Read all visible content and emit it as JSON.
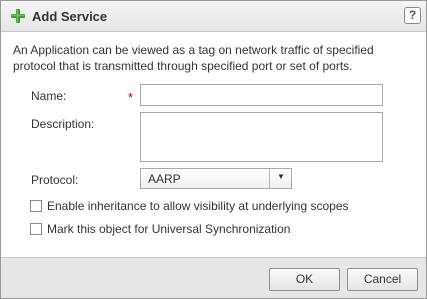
{
  "dialog": {
    "title": "Add Service",
    "title_icon": "green-plus-icon",
    "help_label": "?",
    "accent_color": "#3a9a2a"
  },
  "description": "An Application can be viewed as a tag on network traffic of specified protocol that is transmitted through specified port or set of ports.",
  "form": {
    "name_label": "Name:",
    "required_marker": "*",
    "name_value": "",
    "description_label": "Description:",
    "description_value": "",
    "protocol_label": "Protocol:",
    "protocol_value": "AARP",
    "dropdown_arrow": "▼"
  },
  "options": {
    "inheritance_label": "Enable inheritance to allow visibility at underlying scopes",
    "inheritance_checked": false,
    "universal_label": "Mark this object for Universal Synchronization",
    "universal_checked": false
  },
  "footer": {
    "ok_label": "OK",
    "cancel_label": "Cancel"
  }
}
